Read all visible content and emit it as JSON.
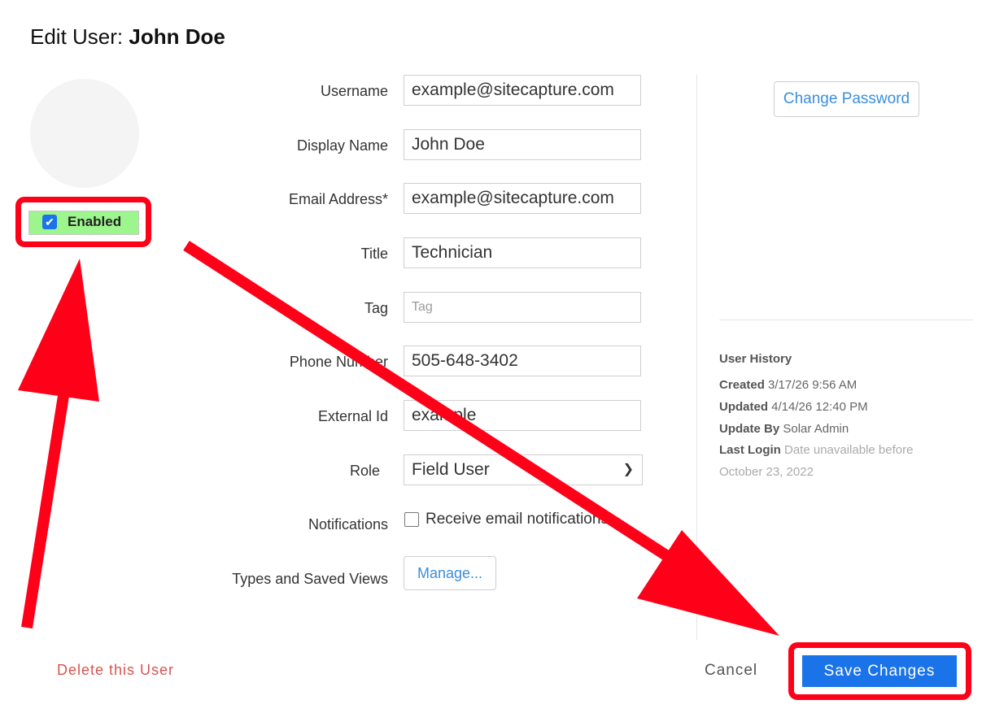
{
  "header": {
    "prefix": "Edit User: ",
    "name": "John Doe"
  },
  "enabled": {
    "label": "Enabled",
    "checked": true
  },
  "fields": {
    "username": {
      "label": "Username",
      "value": "example@sitecapture.com"
    },
    "display_name": {
      "label": "Display Name",
      "value": "John Doe"
    },
    "email": {
      "label": "Email Address*",
      "value": "example@sitecapture.com"
    },
    "title": {
      "label": "Title",
      "value": "Technician"
    },
    "tag": {
      "label": "Tag",
      "placeholder": "Tag"
    },
    "phone": {
      "label": "Phone Number",
      "value": "505-648-3402"
    },
    "external_id": {
      "label": "External Id",
      "value": "example"
    },
    "role": {
      "label": "Role",
      "value": "Field User"
    },
    "notifications": {
      "label": "Notifications",
      "option": "Receive email notifications",
      "checked": false
    },
    "types": {
      "label": "Types and Saved Views",
      "button": "Manage..."
    }
  },
  "sidebar": {
    "change_password": "Change Password",
    "history": {
      "title": "User History",
      "created": {
        "label": "Created",
        "value": "3/17/26 9:56 AM"
      },
      "updated": {
        "label": "Updated",
        "value": "4/14/26 12:40 PM"
      },
      "update_by": {
        "label": "Update By",
        "value": "Solar Admin"
      },
      "last_login": {
        "label": "Last Login",
        "value_line1": "Date unavailable before",
        "value_line2": "October 23, 2022"
      }
    }
  },
  "footer": {
    "delete": "Delete this User",
    "cancel": "Cancel",
    "save": "Save Changes"
  },
  "colors": {
    "accent": "#1a73e8",
    "annotation": "#ff0019",
    "enabled_bg": "#9df58e",
    "danger": "#d9534f"
  },
  "icons": {
    "enabled_checkbox": "checkmark-icon",
    "role_select": "chevron-down-icon"
  }
}
